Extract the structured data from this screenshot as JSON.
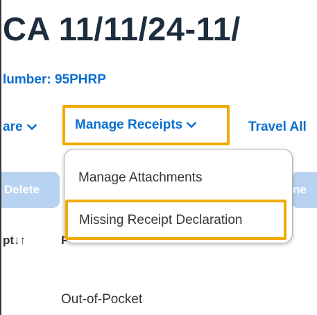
{
  "header": {
    "title": "CA 11/11/24-11/",
    "report_number": "lumber: 95PHRP"
  },
  "toolbar": {
    "share_label": "are",
    "manage_receipts_label": "Manage Receipts",
    "travel_label": "Travel All"
  },
  "actions": {
    "delete_label": "Delete",
    "hidden_label": "ne"
  },
  "dropdown": {
    "items": [
      {
        "label": "Manage Attachments"
      },
      {
        "label": "Missing Receipt Declaration"
      }
    ]
  },
  "table": {
    "receipt_header": "pt↓↑",
    "payment_header": "P",
    "rows": [
      {
        "payment_type": "Out-of-Pocket"
      }
    ]
  },
  "colors": {
    "accent": "#0a6ed1",
    "highlight": "#f0ab00",
    "disabled_button": "#b8d3f1"
  }
}
